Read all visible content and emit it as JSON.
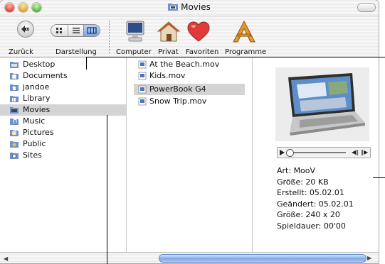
{
  "window": {
    "title": "Movies"
  },
  "toolbar": {
    "back_label": "Zurück",
    "view_label": "Darstellung",
    "computer_label": "Computer",
    "home_label": "Privat",
    "favorites_label": "Favoriten",
    "apps_label": "Programme"
  },
  "sidebar": {
    "items": [
      {
        "label": "Desktop",
        "icon": "desktop-folder-icon"
      },
      {
        "label": "Documents",
        "icon": "documents-folder-icon"
      },
      {
        "label": "jandoe",
        "icon": "home-folder-icon"
      },
      {
        "label": "Library",
        "icon": "library-folder-icon"
      },
      {
        "label": "Movies",
        "icon": "movies-folder-icon",
        "selected": true
      },
      {
        "label": "Music",
        "icon": "music-folder-icon"
      },
      {
        "label": "Pictures",
        "icon": "pictures-folder-icon"
      },
      {
        "label": "Public",
        "icon": "public-folder-icon"
      },
      {
        "label": "Sites",
        "icon": "sites-folder-icon"
      }
    ]
  },
  "files": {
    "items": [
      {
        "label": "At the Beach.mov",
        "icon": "movie-file-icon"
      },
      {
        "label": "Kids.mov",
        "icon": "movie-file-icon"
      },
      {
        "label": "PowerBook G4",
        "icon": "movie-file-icon",
        "selected": true
      },
      {
        "label": "Snow Trip.mov",
        "icon": "movie-file-icon"
      }
    ]
  },
  "preview": {
    "image": "powerbook-laptop-thumbnail",
    "info": {
      "type": "Art: MooV",
      "size": "Größe: 20 KB",
      "created": "Erstellt: 05.02.01",
      "modified": "Geändert: 05.02.01",
      "dimensions": "Größe: 240 x 20",
      "duration": "Spieldauer: 00'00"
    }
  },
  "colors": {
    "selection": "#d4d4d4",
    "aqua_blue": "#7fa8e6"
  }
}
